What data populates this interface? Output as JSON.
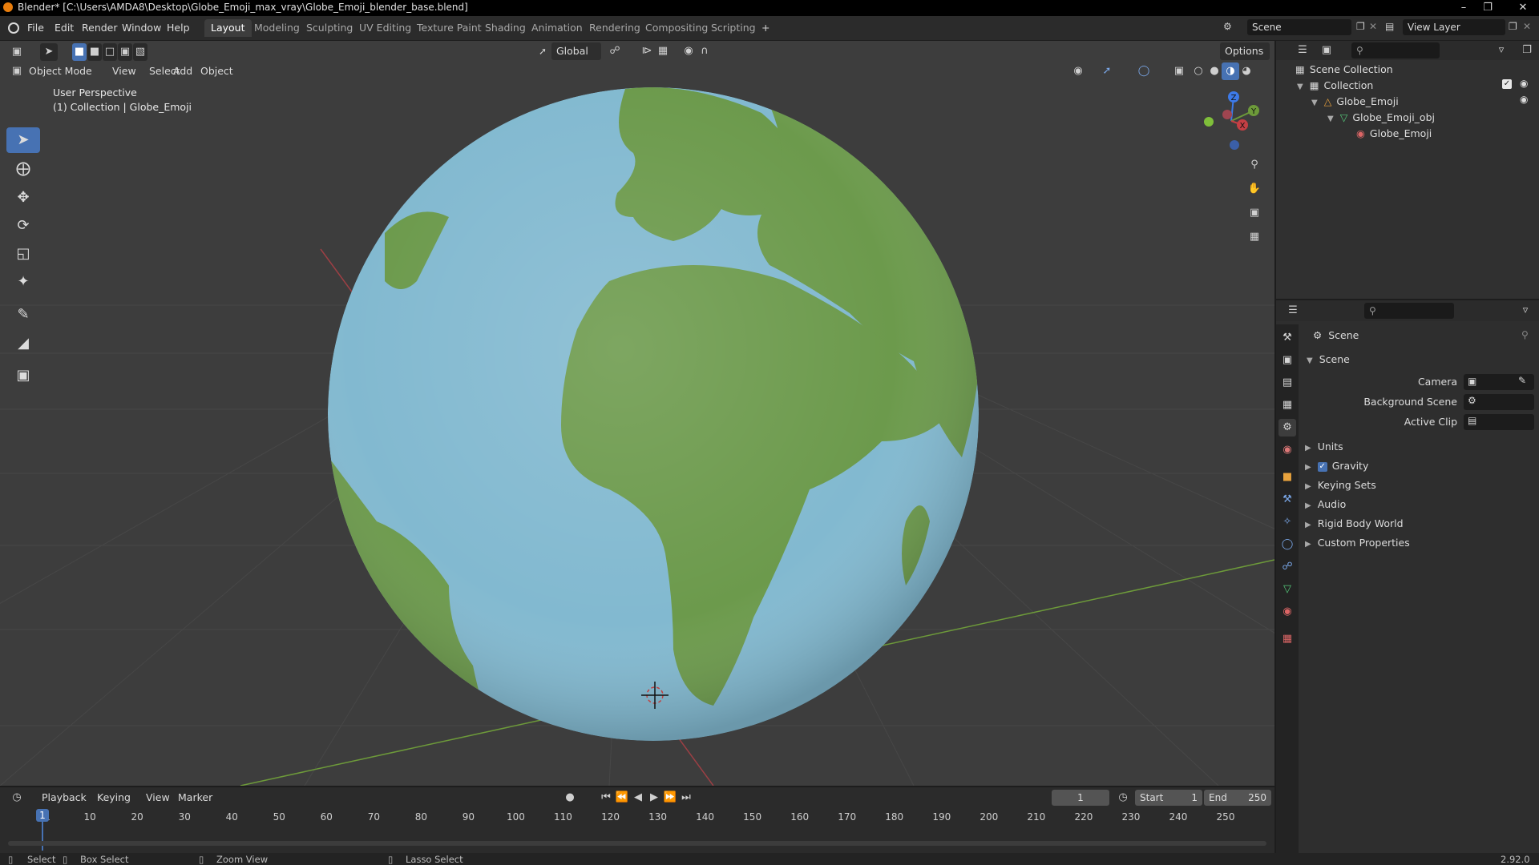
{
  "window": {
    "title": "Blender* [C:\\Users\\AMDA8\\Desktop\\Globe_Emoji_max_vray\\Globe_Emoji_blender_base.blend]"
  },
  "menu": [
    "File",
    "Edit",
    "Render",
    "Window",
    "Help"
  ],
  "workspaces": [
    {
      "label": "Layout",
      "active": true
    },
    {
      "label": "Modeling",
      "active": false
    },
    {
      "label": "Sculpting",
      "active": false
    },
    {
      "label": "UV Editing",
      "active": false
    },
    {
      "label": "Texture Paint",
      "active": false
    },
    {
      "label": "Shading",
      "active": false
    },
    {
      "label": "Animation",
      "active": false
    },
    {
      "label": "Rendering",
      "active": false
    },
    {
      "label": "Compositing",
      "active": false
    },
    {
      "label": "Scripting",
      "active": false
    }
  ],
  "workspace_add": "+",
  "scene_name": "Scene",
  "view_layer": "View Layer",
  "viewport": {
    "transform_orientation": "Global",
    "options_label": "Options",
    "mode": "Object Mode",
    "header_menus": [
      "View",
      "Select",
      "Add",
      "Object"
    ],
    "info_line1": "User Perspective",
    "info_line2": "(1) Collection | Globe_Emoji",
    "gizmo_axes": [
      "X",
      "Y",
      "Z"
    ]
  },
  "outliner": {
    "root": "Scene Collection",
    "items": [
      {
        "label": "Collection",
        "depth": 1
      },
      {
        "label": "Globe_Emoji",
        "depth": 2
      },
      {
        "label": "Globe_Emoji_obj",
        "depth": 3
      },
      {
        "label": "Globe_Emoji",
        "depth": 4
      }
    ]
  },
  "properties": {
    "context": "Scene",
    "section": "Scene",
    "fields": [
      {
        "label": "Camera"
      },
      {
        "label": "Background Scene"
      },
      {
        "label": "Active Clip"
      }
    ],
    "panels": [
      {
        "label": "Units",
        "checkbox": false
      },
      {
        "label": "Gravity",
        "checkbox": true
      },
      {
        "label": "Keying Sets",
        "checkbox": false
      },
      {
        "label": "Audio",
        "checkbox": false
      },
      {
        "label": "Rigid Body World",
        "checkbox": false
      },
      {
        "label": "Custom Properties",
        "checkbox": false
      }
    ]
  },
  "timeline": {
    "menus": [
      "Playback",
      "Keying",
      "View",
      "Marker"
    ],
    "current_frame": "1",
    "start_label": "Start",
    "start": "1",
    "end_label": "End",
    "end": "250",
    "ticks": [
      "1",
      "10",
      "20",
      "30",
      "40",
      "50",
      "60",
      "70",
      "80",
      "90",
      "100",
      "110",
      "120",
      "130",
      "140",
      "150",
      "160",
      "170",
      "180",
      "190",
      "200",
      "210",
      "220",
      "230",
      "240",
      "250"
    ]
  },
  "status": {
    "select": "Select",
    "box_select": "Box Select",
    "zoom_view": "Zoom View",
    "lasso_select": "Lasso Select",
    "version": "2.92.0"
  },
  "colors": {
    "accent": "#4772b3",
    "ocean": "#82b9d0",
    "land": "#6c9a4c",
    "axis_x": "#9c3f44",
    "axis_y": "#6d9a3a"
  }
}
